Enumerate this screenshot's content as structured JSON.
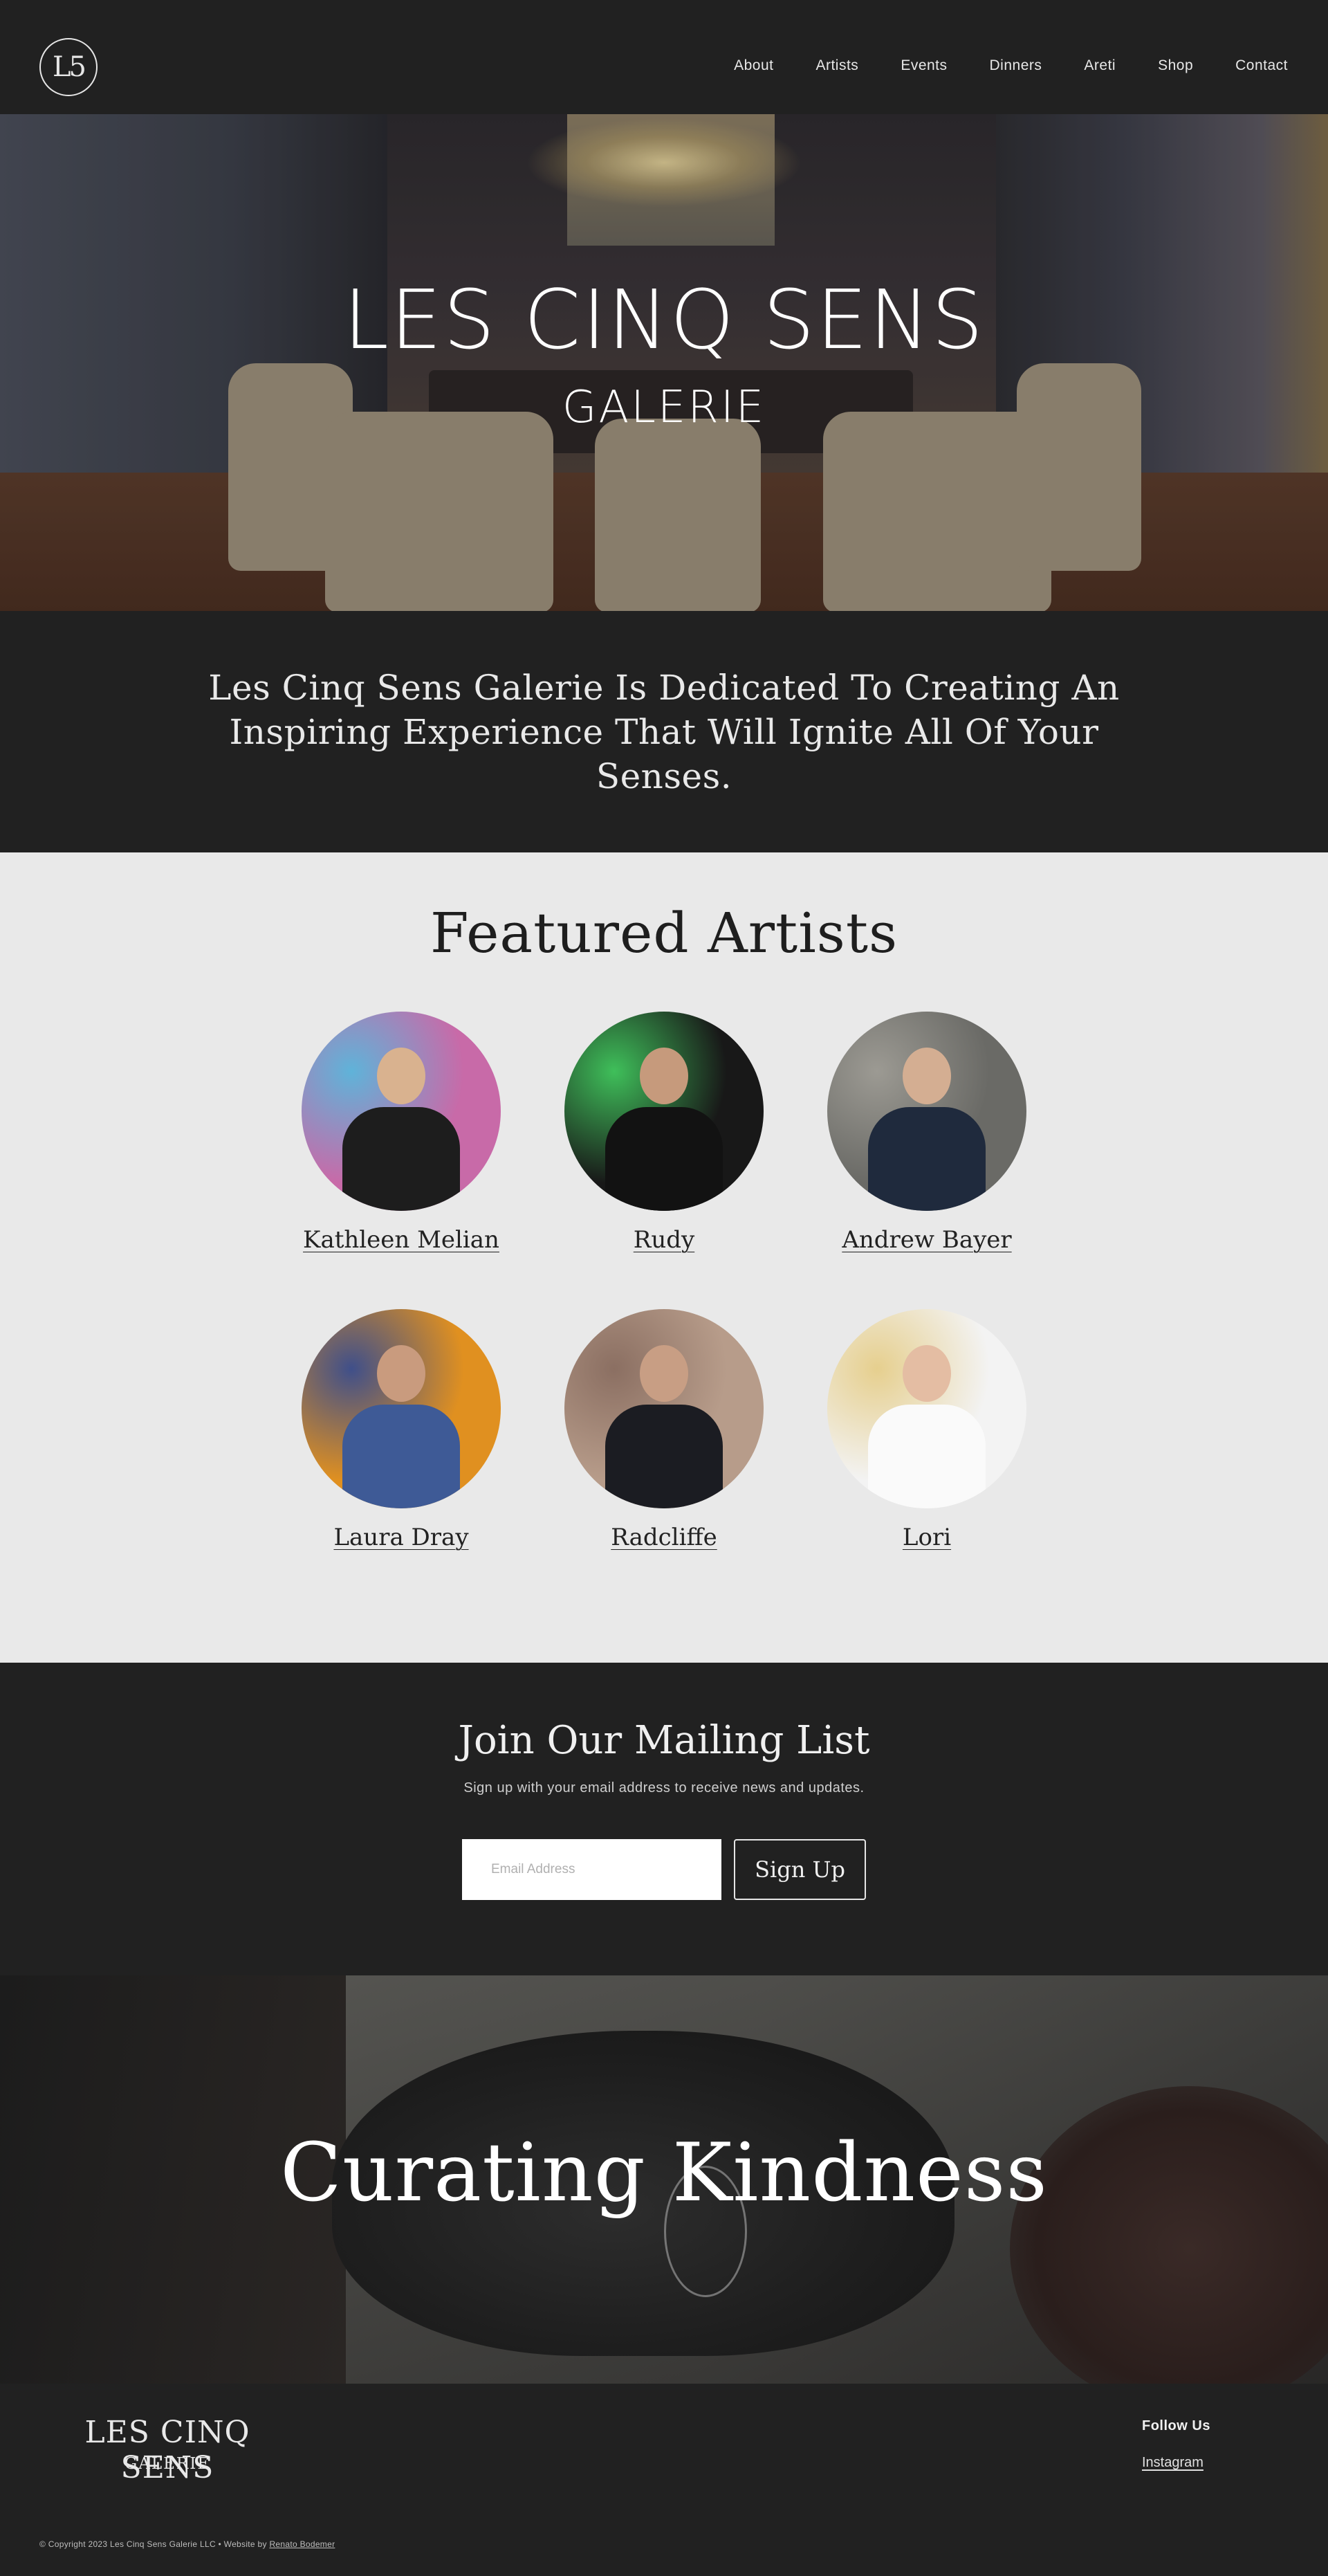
{
  "header": {
    "logo_text": "L5",
    "nav": [
      "About",
      "Artists",
      "Events",
      "Dinners",
      "Areti",
      "Shop",
      "Contact"
    ]
  },
  "hero": {
    "title": "LES CINQ SENS",
    "subtitle": "GALERIE"
  },
  "intro": {
    "text": "Les Cinq Sens Galerie Is Dedicated To Creating An Inspiring Experience That Will Ignite All Of Your Senses."
  },
  "featured": {
    "heading": "Featured Artists",
    "artists": [
      {
        "name": "Kathleen Melian",
        "bg": "#c86aa8",
        "accent": "#5fb3d9",
        "skin": "#d9b28f",
        "clothes": "#1d1d1d"
      },
      {
        "name": "Rudy",
        "bg": "#181818",
        "accent": "#3fbf5a",
        "skin": "#c69a7c",
        "clothes": "#121212"
      },
      {
        "name": "Andrew Bayer",
        "bg": "#6a6a66",
        "accent": "#9c9a93",
        "skin": "#d4ae92",
        "clothes": "#1f2a3d"
      },
      {
        "name": "Laura Dray",
        "bg": "#e09020",
        "accent": "#3f4f8a",
        "skin": "#c99b7e",
        "clothes": "#3e5a96"
      },
      {
        "name": "Radcliffe",
        "bg": "#b79c8a",
        "accent": "#8b6f62",
        "skin": "#c89e84",
        "clothes": "#1b1c22"
      },
      {
        "name": "Lori",
        "bg": "#f3f3f3",
        "accent": "#e6cf8e",
        "skin": "#e4bda3",
        "clothes": "#fafafa"
      }
    ]
  },
  "mailing": {
    "heading": "Join Our Mailing List",
    "description": "Sign up with your email address to receive news and updates.",
    "email_placeholder": "Email Address",
    "button_label": "Sign Up"
  },
  "banner": {
    "heading": "Curating Kindness"
  },
  "footer": {
    "logo_title": "LES CINQ SENS",
    "logo_subtitle": "GALERIE",
    "follow_heading": "Follow Us",
    "instagram_label": "Instagram",
    "copyright_prefix": "© Copyright 2023 Les Cinq Sens Galerie LLC • Website by ",
    "copyright_link": "Renato Bodemer"
  }
}
